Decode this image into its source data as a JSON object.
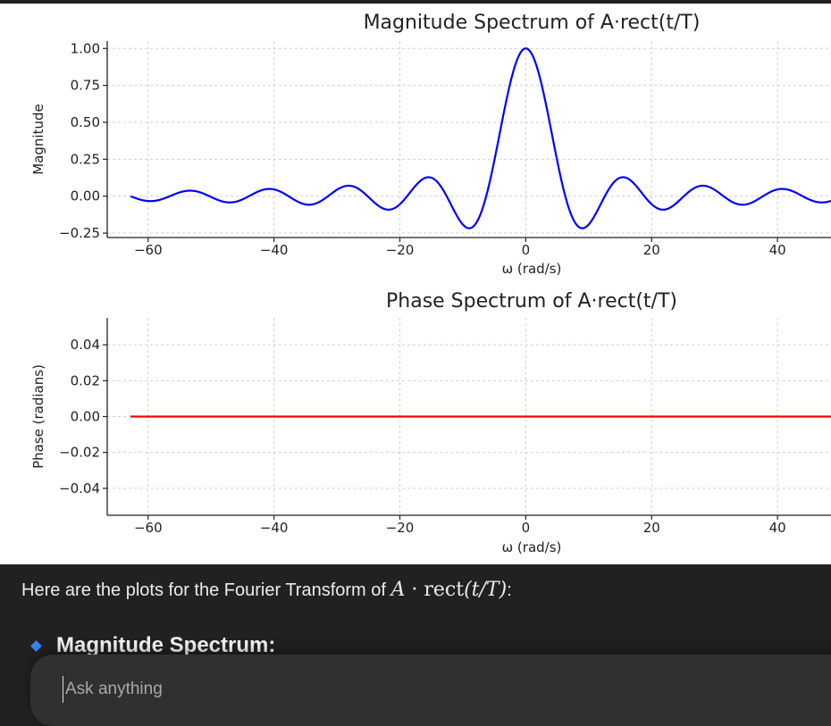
{
  "chart_data": [
    {
      "type": "line",
      "title": "Magnitude Spectrum of A·rect(t/T)",
      "xlabel": "ω (rad/s)",
      "ylabel": "Magnitude",
      "xlim": [
        -66.5,
        48.5
      ],
      "ylim": [
        -0.28,
        1.05
      ],
      "xticks": [
        -60,
        -40,
        -20,
        0,
        20,
        40
      ],
      "xtick_labels": [
        "−60",
        "−40",
        "−20",
        "0",
        "20",
        "40"
      ],
      "yticks": [
        -0.25,
        0,
        0.25,
        0.5,
        0.75,
        1.0
      ],
      "ytick_labels": [
        "−0.25",
        "0.00",
        "0.25",
        "0.50",
        "0.75",
        "1.00"
      ],
      "grid": true,
      "function": "sinc: sin(ω/2)/(ω/2)",
      "x_range": [
        -62.8,
        48.5
      ],
      "series": [
        {
          "color": "#0000ff",
          "x": [
            -62.8,
            -56,
            -50,
            -44,
            -38,
            -32,
            -26,
            -20,
            -14,
            -8,
            -4,
            0,
            4,
            8,
            14,
            20,
            26,
            32,
            38,
            44,
            48.5
          ],
          "values": [
            -0.001,
            0.009,
            -0.038,
            0.002,
            0.002,
            0.018,
            0.032,
            -0.054,
            0.094,
            -0.189,
            0.455,
            1.0,
            0.455,
            -0.189,
            0.094,
            -0.054,
            0.032,
            0.018,
            0.002,
            0.002,
            -0.026
          ]
        }
      ]
    },
    {
      "type": "line",
      "title": "Phase Spectrum of A·rect(t/T)",
      "xlabel": "ω (rad/s)",
      "ylabel": "Phase (radians)",
      "xlim": [
        -66.5,
        48.5
      ],
      "ylim": [
        -0.055,
        0.055
      ],
      "xticks": [
        -60,
        -40,
        -20,
        0,
        20,
        40
      ],
      "xtick_labels": [
        "−60",
        "−40",
        "−20",
        "0",
        "20",
        "40"
      ],
      "yticks": [
        -0.04,
        -0.02,
        0,
        0.02,
        0.04
      ],
      "ytick_labels": [
        "−0.04",
        "−0.02",
        "0.00",
        "0.02",
        "0.04"
      ],
      "grid": true,
      "series": [
        {
          "color": "#ff0000",
          "x": [
            -62.8,
            48.5
          ],
          "values": [
            0,
            0
          ]
        }
      ]
    }
  ],
  "message": {
    "text_before": "Here are the plots for the Fourier Transform of ",
    "math_A": "A",
    "math_dot": " · ",
    "math_rect": "rect",
    "math_arg": "(t/T)",
    "text_after": ":"
  },
  "section_heading": "Magnitude Spectrum:",
  "composer": {
    "placeholder": "Ask anything"
  },
  "colors": {
    "bullet": "#3b82f6",
    "background": "#212121",
    "composer": "#303030"
  }
}
